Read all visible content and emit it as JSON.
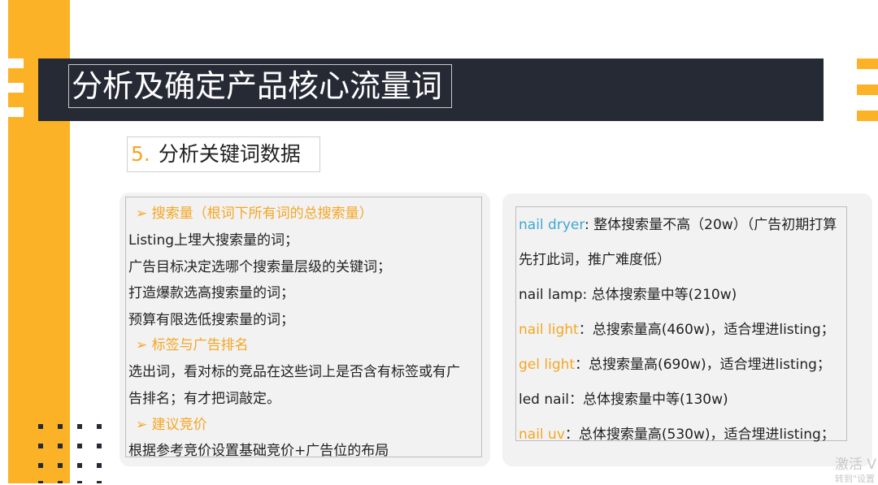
{
  "slide": {
    "title": "分析及确定产品核心流量词",
    "section_number": "5.",
    "section_title": "分析关键词数据"
  },
  "left_panel": {
    "heading_1": "➢ 搜索量（根词下所有词的总搜索量）",
    "items_1": [
      "Listing上埋大搜索量的词；",
      "广告目标决定选哪个搜索量层级的关键词；",
      "打造爆款选高搜索量的词；",
      "预算有限选低搜索量的词；"
    ],
    "heading_2": "➢ 标签与广告排名",
    "items_2": [
      "选出词，看对标的竞品在这些词上是否含有标签或有广",
      "告排名；有才把词敲定。"
    ],
    "heading_3": "➢ 建议竞价",
    "items_3": [
      "根据参考竞价设置基础竞价+广告位的布局"
    ]
  },
  "right_panel": {
    "entries": [
      {
        "keyword": "nail dryer",
        "text": ": 整体搜索量不高（20w）（广告初期打算",
        "color": "#3FA7D6"
      },
      {
        "keyword": "",
        "text": "先打此词，推广难度低）",
        "color": ""
      },
      {
        "keyword": "",
        "text": "nail lamp: 总体搜索量中等(210w)",
        "color": ""
      },
      {
        "keyword": "nail light",
        "text": "：总搜索量高(460w)，适合埋进listing；",
        "color": "#F5A623"
      },
      {
        "keyword": "gel light",
        "text": "：总搜索量高(690w)，适合埋进listing；",
        "color": "#F5A623"
      },
      {
        "keyword": "",
        "text": "led nail：总体搜索量中等(130w)",
        "color": ""
      },
      {
        "keyword": "nail uv",
        "text": "：总体搜索量高(530w)，适合埋进listing；",
        "color": "#F5A623"
      }
    ]
  },
  "watermark": {
    "line1": "激活 V",
    "line2": "转到\"设置"
  },
  "colors": {
    "accent_orange": "#FBB227",
    "banner_dark": "#262A35",
    "keyword_blue": "#3FA7D6",
    "keyword_orange": "#F5A623",
    "panel_bg": "#F2F2F2"
  }
}
